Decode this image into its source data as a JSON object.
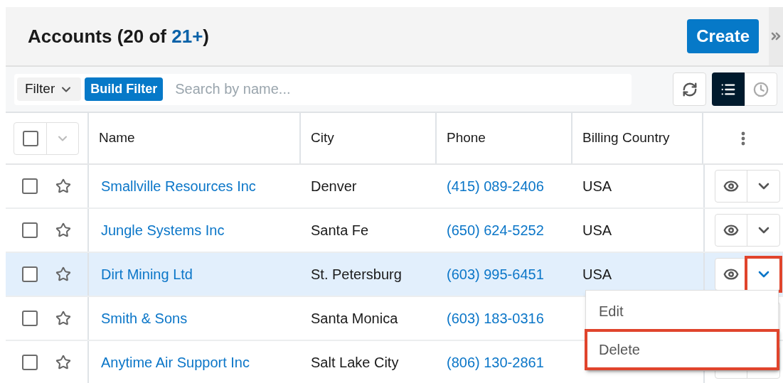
{
  "header": {
    "title": "Accounts (20 of ",
    "count": "21+",
    "title_end": ")",
    "create_button": "Create"
  },
  "toolbar": {
    "filter": "Filter",
    "build_filter": "Build Filter",
    "search": {
      "placeholder": "Search by name..."
    },
    "views": [
      {
        "kind": "list",
        "selected": true
      },
      {
        "kind": "activity",
        "selected": false
      }
    ]
  },
  "table": {
    "select_all": {
      "checked": false
    },
    "columns": [
      "Name",
      "City",
      "Phone",
      "Billing Country"
    ],
    "rows": [
      {
        "checked": false,
        "favorite": false,
        "selected": false,
        "name": "Smallville Resources Inc",
        "city": "Denver",
        "phone": "(415) 089-2406",
        "billing_country": "USA",
        "menu_open": false
      },
      {
        "checked": false,
        "favorite": false,
        "selected": false,
        "name": "Jungle Systems Inc",
        "city": "Santa Fe",
        "phone": "(650) 624-5252",
        "billing_country": "USA",
        "menu_open": false
      },
      {
        "checked": false,
        "favorite": false,
        "selected": true,
        "name": "Dirt Mining Ltd",
        "city": "St. Petersburg",
        "phone": "(603) 995-6451",
        "billing_country": "USA",
        "menu_open": true
      },
      {
        "checked": false,
        "favorite": false,
        "selected": false,
        "name": "Smith & Sons",
        "city": "Santa Monica",
        "phone": "(603) 183-0316",
        "menu_open": false
      },
      {
        "checked": false,
        "favorite": false,
        "selected": false,
        "name": "Anytime Air Support Inc",
        "city": "Salt Lake City",
        "phone": "(806) 130-2861",
        "menu_open": false
      }
    ]
  },
  "row_menu": {
    "items": [
      {
        "label": "Edit",
        "highlighted": false
      },
      {
        "label": "Delete",
        "highlighted": true
      }
    ]
  }
}
